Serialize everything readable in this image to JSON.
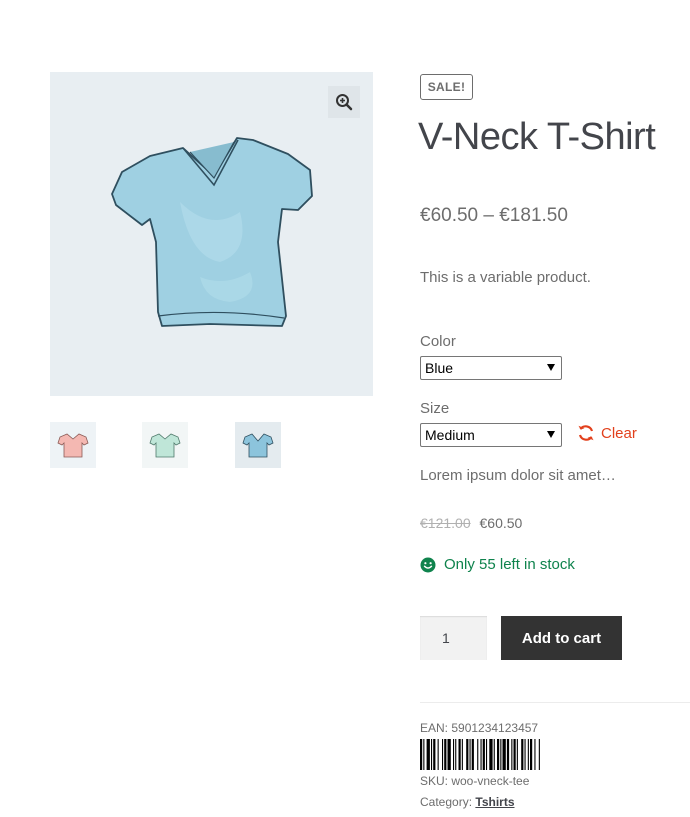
{
  "gallery": {
    "main_image_alt": "V-Neck T-Shirt",
    "thumbnails": [
      {
        "color_name": "pink",
        "fill": "#f4b8b2"
      },
      {
        "color_name": "mint",
        "fill": "#bfe6d8"
      },
      {
        "color_name": "blue",
        "fill": "#8cc4dc"
      }
    ],
    "zoom_icon": "magnifier-plus-icon"
  },
  "product": {
    "badge": "SALE!",
    "title": "V-Neck T-Shirt",
    "price_range": "€60.50 – €181.50",
    "short_description": "This is a variable product."
  },
  "variations": {
    "color_label": "Color",
    "color_value": "Blue",
    "size_label": "Size",
    "size_value": "Medium",
    "clear_label": "Clear",
    "clear_icon": "refresh-icon"
  },
  "selected_variation": {
    "description": "Lorem ipsum dolor sit amet…",
    "regular_price": "€121.00",
    "sale_price": "€60.50",
    "stock_text": "Only 55 left in stock",
    "stock_icon": "smiley-icon"
  },
  "cart": {
    "quantity": "1",
    "add_to_cart_label": "Add to cart"
  },
  "meta": {
    "ean_text": "EAN: 5901234123457",
    "sku_text": "SKU: woo-vneck-tee",
    "category_prefix": "Category:",
    "category_link": "Tshirts"
  },
  "colors": {
    "accent_red": "#e2401c",
    "stock_green": "#0f834d",
    "button_dark": "#333333",
    "shirt_blue": "#9fd0e2"
  }
}
